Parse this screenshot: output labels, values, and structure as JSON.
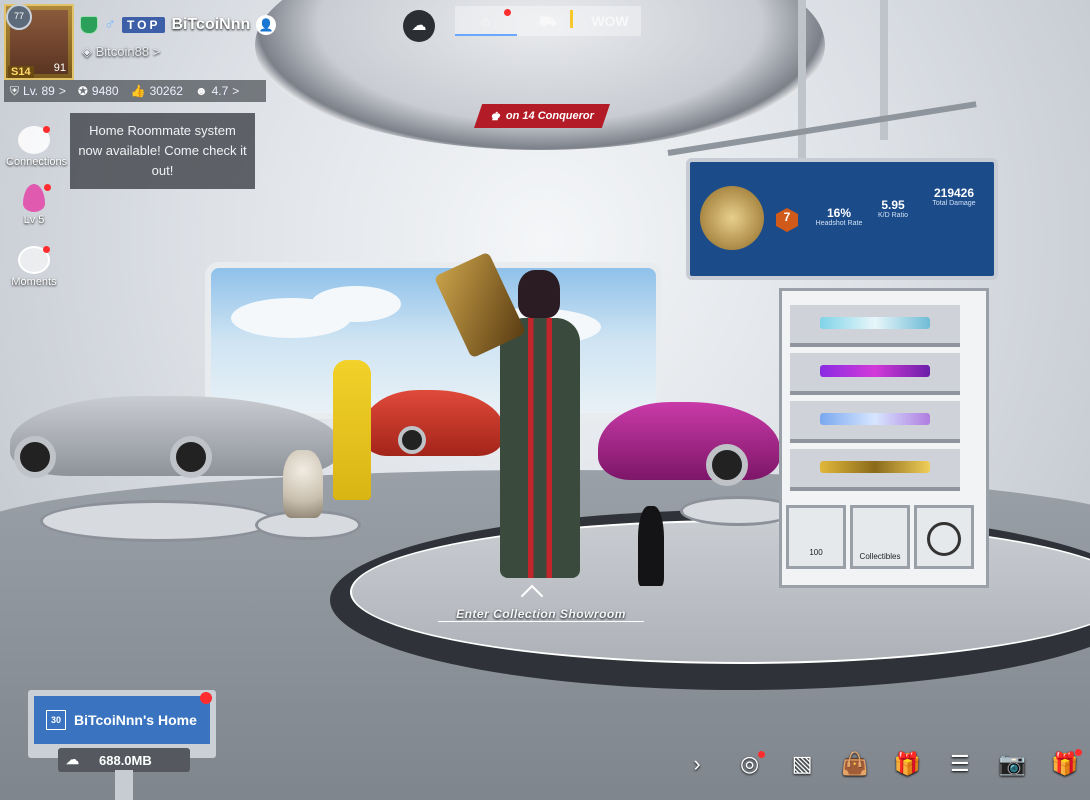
{
  "profile": {
    "season": "S14",
    "level_badge": "91",
    "rank_badge": "77",
    "team_tag": "TOP",
    "player_name": "BiTcoiNnn",
    "clan": "Bitcoin88",
    "clan_chevron": ">",
    "stats": [
      {
        "icon": "level-icon",
        "value": "Lv. 89",
        "suffix": ">"
      },
      {
        "icon": "popularity-icon",
        "value": "9480"
      },
      {
        "icon": "like-icon",
        "value": "30262"
      },
      {
        "icon": "emote-icon",
        "value": "4.7",
        "suffix": ">"
      }
    ]
  },
  "sidebar": {
    "items": [
      {
        "label": "Connections",
        "icon": "connections-icon"
      },
      {
        "label": "Lv 5",
        "icon": "flame-icon"
      },
      {
        "label": "Moments",
        "icon": "moments-icon"
      }
    ]
  },
  "tooltip": {
    "text": "Home Roommate system now available! Come check it out!"
  },
  "top_tabs": [
    {
      "label": "",
      "icon": "home-icon",
      "active": true
    },
    {
      "label": "",
      "icon": "vehicle-icon",
      "active": false
    },
    {
      "label": "WOW",
      "icon": "",
      "active": false
    }
  ],
  "banner": {
    "conqueror": "on 14 Conqueror"
  },
  "board": {
    "rank_number": "7",
    "headshot_value": "16%",
    "headshot_label": "Headshot Rate",
    "kd_value": "5.95",
    "kd_label": "K/D Ratio",
    "damage_value": "219426",
    "damage_label": "Total Damage"
  },
  "rack": {
    "cubbies": [
      {
        "label": "100"
      },
      {
        "label": "Collectibles"
      },
      {
        "label": ""
      }
    ]
  },
  "showroom": {
    "enter_label": "Enter Collection Showroom"
  },
  "home": {
    "level": "30",
    "title": "BiTcoiNnn's Home",
    "size": "688.0MB"
  },
  "toolbar": {
    "icons": [
      "chevron-right-icon",
      "rotate-camera-icon",
      "image-icon",
      "shop-bag-icon",
      "gift-icon",
      "view-list-icon",
      "camera-icon",
      "gift-box-icon"
    ]
  },
  "colors": {
    "accent_blue": "#3a74c0",
    "conqueror_red": "#b31b26",
    "notification_red": "#ff2d2d"
  }
}
